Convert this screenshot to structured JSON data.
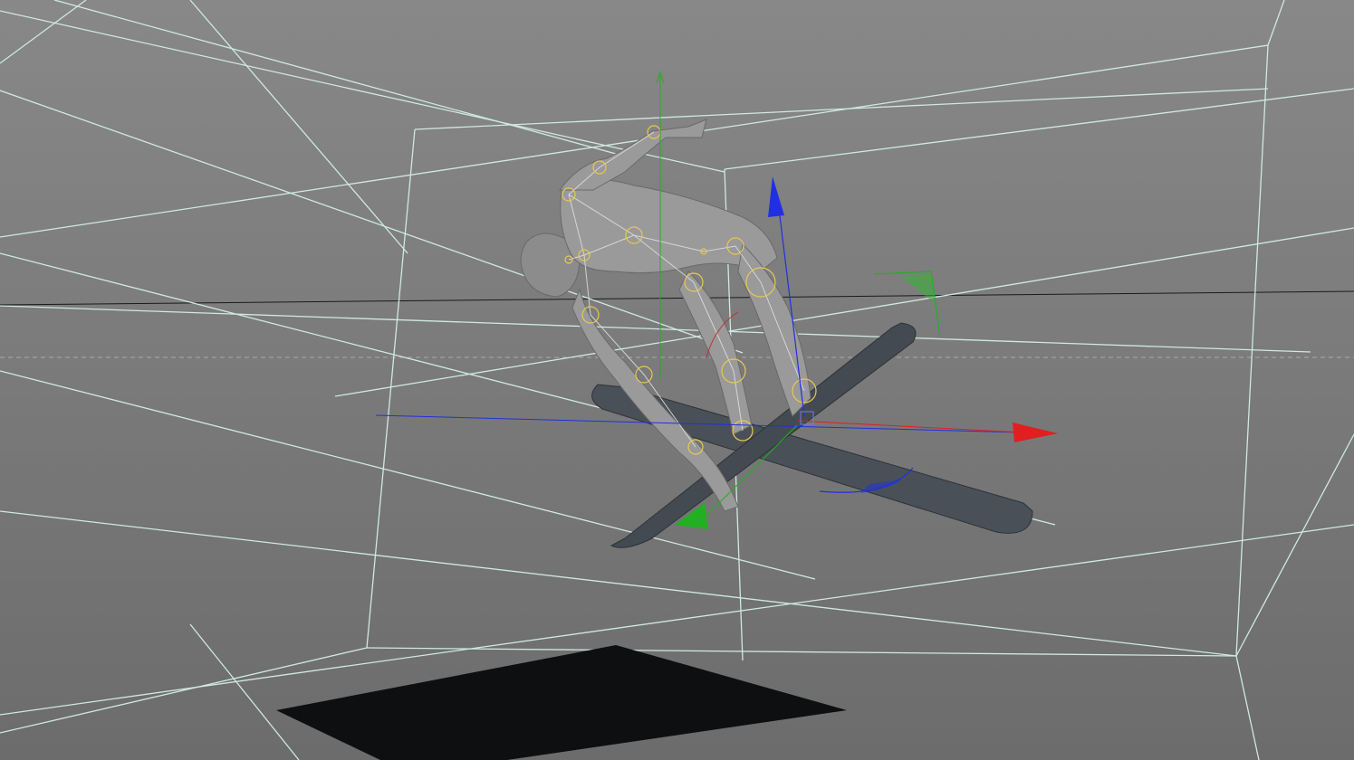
{
  "viewport": {
    "name": "3d-viewport",
    "background_top": "#888888",
    "background_bottom": "#6c6c6c"
  },
  "colors": {
    "wireframe": "#cfe9e2",
    "horizon": "#1a1a1a",
    "axis_x": "#e02020",
    "axis_y": "#22b022",
    "axis_z": "#2030e0",
    "joint": "#e8c850",
    "body": "#9a9a9a",
    "ski": "#4a5058",
    "shadow": "#0e0f10"
  },
  "icons": {
    "move_gizmo": "transform-gizmo-icon",
    "rotate_ring": "rotate-handle-icon"
  }
}
